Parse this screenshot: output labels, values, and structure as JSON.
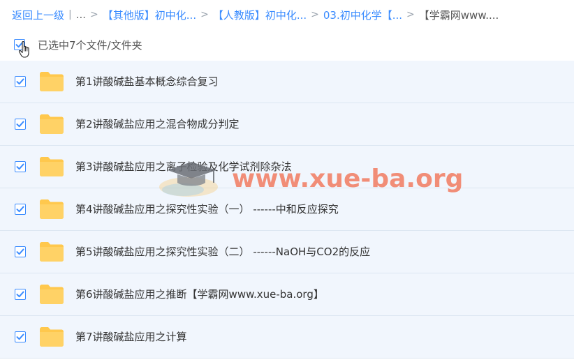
{
  "breadcrumb": {
    "back": "返回上一级",
    "ellipsis": "...",
    "items": [
      "【其他版】初中化...",
      "【人教版】初中化...",
      "03.初中化学【..."
    ],
    "current": "【学霸网www...."
  },
  "selection": {
    "label": "已选中7个文件/文件夹"
  },
  "files": [
    {
      "name": "第1讲酸碱盐基本概念综合复习"
    },
    {
      "name": "第2讲酸碱盐应用之混合物成分判定"
    },
    {
      "name": "第3讲酸碱盐应用之离子检验及化学试剂除杂法"
    },
    {
      "name": "第4讲酸碱盐应用之探究性实验（一） ------中和反应探究"
    },
    {
      "name": "第5讲酸碱盐应用之探究性实验（二） ------NaOH与CO2的反应"
    },
    {
      "name": "第6讲酸碱盐应用之推断【学霸网www.xue-ba.org】"
    },
    {
      "name": "第7讲酸碱盐应用之计算"
    }
  ],
  "watermark": {
    "text": "www.xue-ba.org"
  },
  "colors": {
    "link": "#3b8cff",
    "row_bg": "#f1f6fd",
    "folder": "#ffc84d",
    "checkbox": "#3b8cff"
  }
}
